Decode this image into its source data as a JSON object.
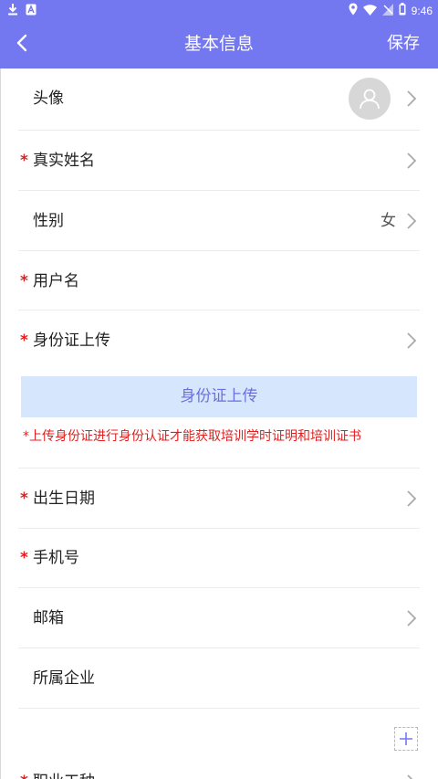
{
  "status_bar": {
    "time": "9:46",
    "left_icons": [
      "download-icon",
      "a-icon"
    ],
    "right_icons": [
      "location-icon",
      "wifi-icon",
      "signal-icon",
      "battery-icon"
    ]
  },
  "header": {
    "title": "基本信息",
    "back_icon": "chevron-left-icon",
    "save_label": "保存",
    "background": "#7478f0"
  },
  "rows": {
    "avatar": {
      "label": "头像",
      "required": false
    },
    "real_name": {
      "label": "真实姓名",
      "required": true
    },
    "gender": {
      "label": "性别",
      "value": "女",
      "required": false
    },
    "username": {
      "label": "用户名",
      "required": true
    },
    "id_upload": {
      "label": "身份证上传",
      "required": true
    },
    "birth_date": {
      "label": "出生日期",
      "required": true
    },
    "phone": {
      "label": "手机号",
      "required": true
    },
    "email": {
      "label": "邮箱",
      "required": false
    },
    "company": {
      "label": "所属企业",
      "required": false
    }
  },
  "required_mark": "*",
  "id_upload_box": {
    "label": "身份证上传",
    "note": "*上传身份证进行身份认证才能获取培训学时证明和培训证书",
    "background": "#d6e7fd"
  },
  "add_button_icon": "plus-icon",
  "partial_row_label": "职业工种",
  "colors": {
    "accent": "#7478f0",
    "required": "#e02020",
    "divider": "#ececec"
  }
}
